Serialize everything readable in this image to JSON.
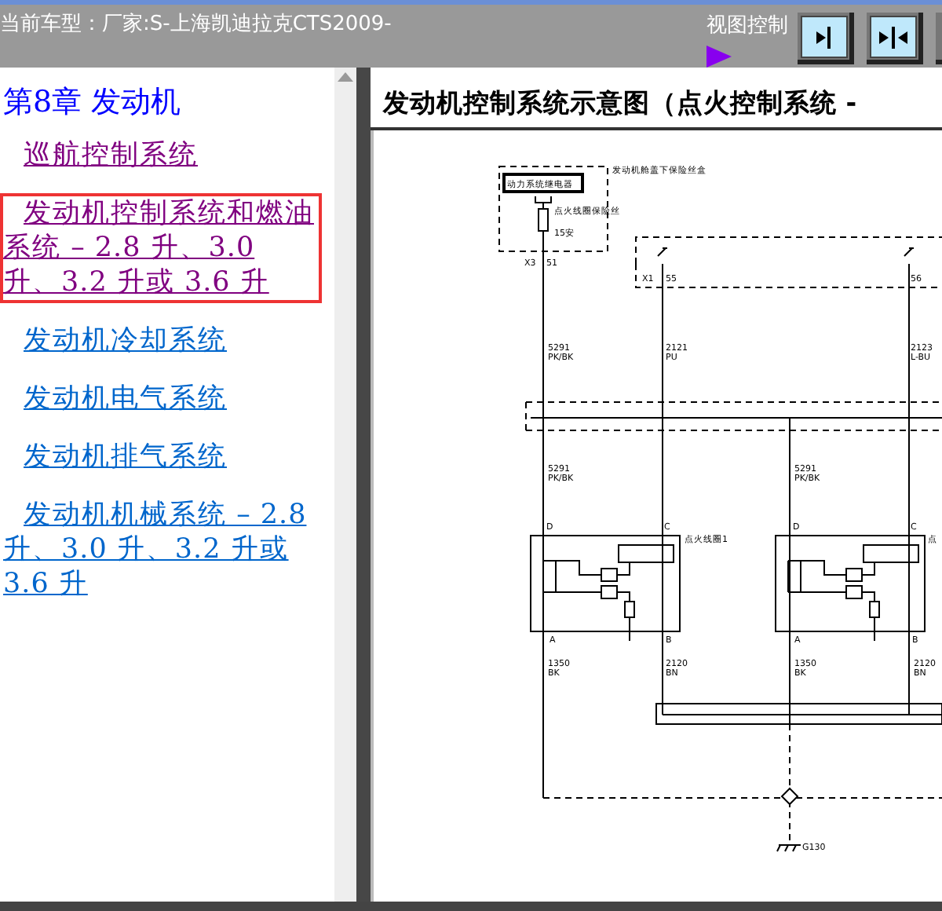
{
  "top_bar": {
    "vehicle": "当前车型：厂家:S-上海凯迪拉克CTS2009-",
    "view_control": "视图控制"
  },
  "toolbar_buttons": [
    {
      "kind": "arrow-right"
    },
    {
      "kind": "arrows-in"
    },
    {
      "kind": "edge"
    }
  ],
  "nav": {
    "chapter": "第8章  发动机",
    "items": [
      {
        "label": "巡航控制系统",
        "visited": true,
        "selected": false
      },
      {
        "label": "发动机控制系统和燃油系统 – 2.8 升、3.0 升、3.2 升或 3.6 升",
        "visited": true,
        "selected": true
      },
      {
        "label": "发动机冷却系统",
        "visited": false,
        "selected": false
      },
      {
        "label": "发动机电气系统",
        "visited": false,
        "selected": false
      },
      {
        "label": "发动机排气系统",
        "visited": false,
        "selected": false
      },
      {
        "label": "发动机机械系统 – 2.8 升、3.0 升、3.2 升或 3.6 升",
        "visited": false,
        "selected": false
      }
    ]
  },
  "document": {
    "title": "发动机控制系统示意图（点火控制系统 -",
    "diagram_labels": [
      "发动机舱盖下保险丝盒",
      "动力系统继电器",
      "点火线圈保险丝",
      "15安",
      "X3",
      "51",
      "X1",
      "55",
      "56",
      "5291",
      "PK/BK",
      "2121",
      "PU",
      "2123",
      "L-BU",
      "5291",
      "PK/BK",
      "5291",
      "PK/BK",
      "D",
      "C",
      "点火线圈1",
      "D",
      "C",
      "点",
      "A",
      "B",
      "A",
      "B",
      "1350",
      "BK",
      "2120",
      "BN",
      "1350",
      "BK",
      "2120",
      "BN",
      "G130"
    ]
  }
}
